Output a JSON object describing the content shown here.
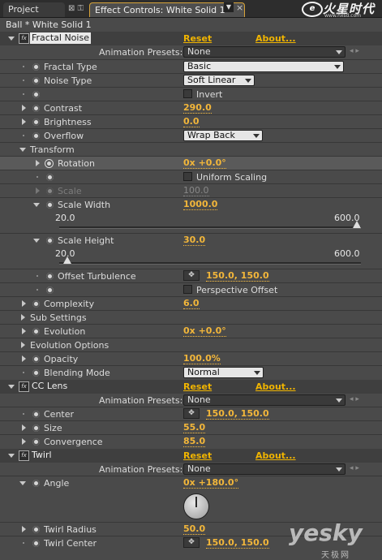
{
  "tabs": {
    "project": "Project",
    "effect_controls": "Effect Controls: White Solid 1"
  },
  "logo": {
    "main": "火星时代",
    "sub": "www.hxsd.com",
    "mark": "e"
  },
  "layer_title": "Ball * White Solid 1",
  "common": {
    "reset": "Reset",
    "about": "About...",
    "animation_presets": "Animation Presets:",
    "presets_value": "None"
  },
  "fractal_noise": {
    "name": "Fractal Noise",
    "fractal_type": {
      "label": "Fractal Type",
      "value": "Basic"
    },
    "noise_type": {
      "label": "Noise Type",
      "value": "Soft Linear"
    },
    "invert": {
      "label": "Invert",
      "checked": false
    },
    "contrast": {
      "label": "Contrast",
      "value": "290.0"
    },
    "brightness": {
      "label": "Brightness",
      "value": "0.0"
    },
    "overflow": {
      "label": "Overflow",
      "value": "Wrap Back"
    },
    "transform": {
      "label": "Transform",
      "rotation": {
        "label": "Rotation",
        "value": "0x +0.0°"
      },
      "uniform_scaling": {
        "label": "Uniform Scaling",
        "checked": false
      },
      "scale": {
        "label": "Scale",
        "value": "100.0"
      },
      "scale_width": {
        "label": "Scale Width",
        "value": "1000.0",
        "min": "20.0",
        "max": "600.0",
        "level": 1.0
      },
      "scale_height": {
        "label": "Scale Height",
        "value": "30.0",
        "min": "20.0",
        "max": "600.0",
        "level": 0.017
      },
      "offset_turbulence": {
        "label": "Offset Turbulence",
        "value": "150.0, 150.0"
      },
      "perspective_offset": {
        "label": "Perspective Offset",
        "checked": false
      }
    },
    "complexity": {
      "label": "Complexity",
      "value": "6.0"
    },
    "sub_settings": {
      "label": "Sub Settings"
    },
    "evolution": {
      "label": "Evolution",
      "value": "0x +0.0°"
    },
    "evolution_options": {
      "label": "Evolution Options"
    },
    "opacity": {
      "label": "Opacity",
      "value": "100.0%"
    },
    "blending_mode": {
      "label": "Blending Mode",
      "value": "Normal"
    }
  },
  "cc_lens": {
    "name": "CC Lens",
    "center": {
      "label": "Center",
      "value": "150.0, 150.0"
    },
    "size": {
      "label": "Size",
      "value": "55.0"
    },
    "convergence": {
      "label": "Convergence",
      "value": "85.0"
    }
  },
  "twirl": {
    "name": "Twirl",
    "angle": {
      "label": "Angle",
      "value": "0x +180.0°"
    },
    "twirl_radius": {
      "label": "Twirl Radius",
      "value": "50.0"
    },
    "twirl_center": {
      "label": "Twirl Center",
      "value": "150.0, 150.0"
    }
  },
  "watermark": {
    "main": "yesky",
    "sub": "天极网"
  },
  "colors": {
    "value": "#f2b63a",
    "link": "#f0b400",
    "panel": "#4a4a4a",
    "tab_accent": "#d7a43a"
  }
}
